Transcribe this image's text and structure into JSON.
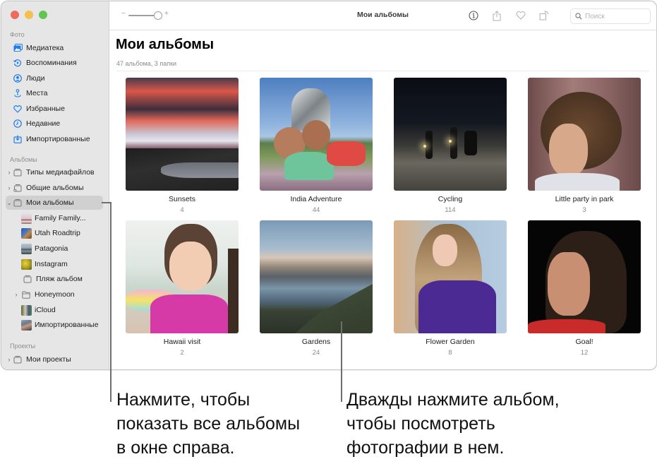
{
  "window": {
    "title": "Мои альбомы",
    "controls": [
      "close",
      "minimize",
      "zoom"
    ]
  },
  "sidebar": {
    "sections": [
      {
        "label": "Фото",
        "items": [
          {
            "label": "Медиатека",
            "icon": "photo-library-icon"
          },
          {
            "label": "Воспоминания",
            "icon": "memories-icon"
          },
          {
            "label": "Люди",
            "icon": "people-icon"
          },
          {
            "label": "Места",
            "icon": "places-icon"
          },
          {
            "label": "Избранные",
            "icon": "heart-icon"
          },
          {
            "label": "Недавние",
            "icon": "clock-icon"
          },
          {
            "label": "Импортированные",
            "icon": "import-icon"
          }
        ]
      },
      {
        "label": "Альбомы",
        "items": [
          {
            "label": "Типы медиафайлов",
            "icon": "album-stack-icon",
            "expandable": true,
            "expanded": false
          },
          {
            "label": "Общие альбомы",
            "icon": "shared-album-icon",
            "expandable": true,
            "expanded": false
          },
          {
            "label": "Мои альбомы",
            "icon": "album-stack-icon",
            "expandable": true,
            "expanded": true,
            "selected": true
          },
          {
            "label": "Family Family...",
            "icon": "thumbnail",
            "child": true
          },
          {
            "label": "Utah Roadtrip",
            "icon": "thumbnail",
            "child": true
          },
          {
            "label": "Patagonia",
            "icon": "thumbnail",
            "child": true
          },
          {
            "label": "Instagram",
            "icon": "thumbnail",
            "child": true
          },
          {
            "label": "Пляж альбом",
            "icon": "album-stack-icon",
            "child": true
          },
          {
            "label": "Honeymoon",
            "icon": "folder-icon",
            "child": true,
            "expandable": true,
            "expanded": false
          },
          {
            "label": "iCloud",
            "icon": "thumbnail",
            "child": true
          },
          {
            "label": "Импортированные",
            "icon": "thumbnail",
            "child": true
          }
        ]
      },
      {
        "label": "Проекты",
        "items": [
          {
            "label": "Мои проекты",
            "icon": "album-stack-icon",
            "expandable": true,
            "expanded": false
          }
        ]
      }
    ]
  },
  "toolbar": {
    "zoom_minus": "−",
    "zoom_plus": "+",
    "zoom_level": 0.85,
    "title": "Мои альбомы",
    "buttons": [
      "info-icon",
      "share-icon",
      "heart-icon",
      "rotate-icon"
    ],
    "search_placeholder": "Поиск",
    "search_value": ""
  },
  "main": {
    "title": "Мои альбомы",
    "subtitle": "47 альбома, 3 папки",
    "albums": [
      {
        "name": "Sunsets",
        "count": "4"
      },
      {
        "name": "India Adventure",
        "count": "44"
      },
      {
        "name": "Cycling",
        "count": "114"
      },
      {
        "name": "Little party in park",
        "count": "3"
      },
      {
        "name": "Hawaii visit",
        "count": "2"
      },
      {
        "name": "Gardens",
        "count": "24"
      },
      {
        "name": "Flower Garden",
        "count": "8"
      },
      {
        "name": "Goal!",
        "count": "12"
      }
    ]
  },
  "callouts": [
    {
      "text_lines": [
        "Нажмите, чтобы",
        "показать все альбомы",
        "в окне справа."
      ]
    },
    {
      "text_lines": [
        "Дважды нажмите альбом,",
        "чтобы посмотреть",
        "фотографии в нем."
      ]
    }
  ],
  "colors": {
    "accent": "#1a7bf2",
    "sidebar_bg": "#e6e6e6",
    "selection_bg": "#d0d0d0"
  }
}
